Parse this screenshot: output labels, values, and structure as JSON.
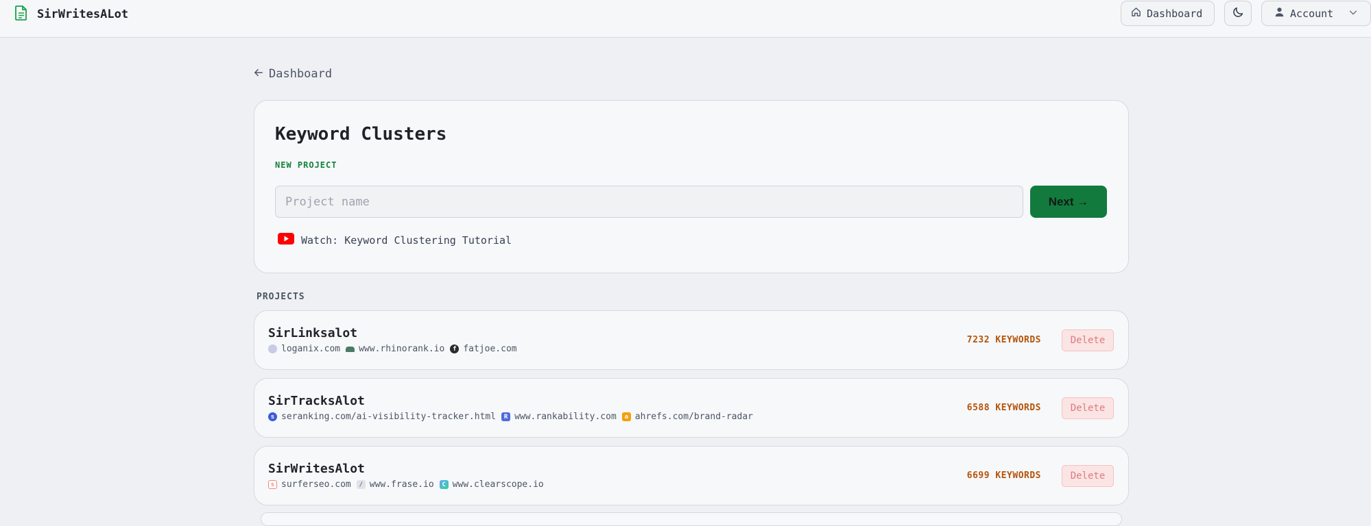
{
  "app": {
    "title": "SirWritesALot",
    "nav": {
      "dashboard_label": "Dashboard",
      "account_label": "Account"
    }
  },
  "page": {
    "back_label": "Dashboard",
    "heading": "Keyword Clusters",
    "new_project_label": "NEW PROJECT",
    "project_name_placeholder": "Project name",
    "project_name_value": "",
    "next_label": "Next →",
    "tutorial_link": "Watch: Keyword Clustering Tutorial",
    "projects_label": "PROJECTS"
  },
  "projects": [
    {
      "name": "SirLinksalot",
      "keywords_label": "7232 KEYWORDS",
      "delete_label": "Delete",
      "sites": [
        "loganix.com",
        "www.rhinorank.io",
        "fatjoe.com"
      ]
    },
    {
      "name": "SirTracksAlot",
      "keywords_label": "6588 KEYWORDS",
      "delete_label": "Delete",
      "sites": [
        "seranking.com/ai-visibility-tracker.html",
        "www.rankability.com",
        "ahrefs.com/brand-radar"
      ]
    },
    {
      "name": "SirWritesAlot",
      "keywords_label": "6699 KEYWORDS",
      "delete_label": "Delete",
      "sites": [
        "surferseo.com",
        "www.frase.io",
        "www.clearscope.io"
      ]
    }
  ],
  "colors": {
    "accent_green": "#137a3e",
    "label_green": "#15803d",
    "keyword_amber": "#b45309",
    "delete_red": "#e07a7a",
    "youtube_red": "#ff0000"
  },
  "icons": {
    "brand": "document-icon",
    "dashboard": "home-icon",
    "theme": "moon-icon",
    "account": "user-icon",
    "account_menu": "chevron-down-icon",
    "back": "arrow-left-icon",
    "tutorial": "youtube-icon"
  }
}
